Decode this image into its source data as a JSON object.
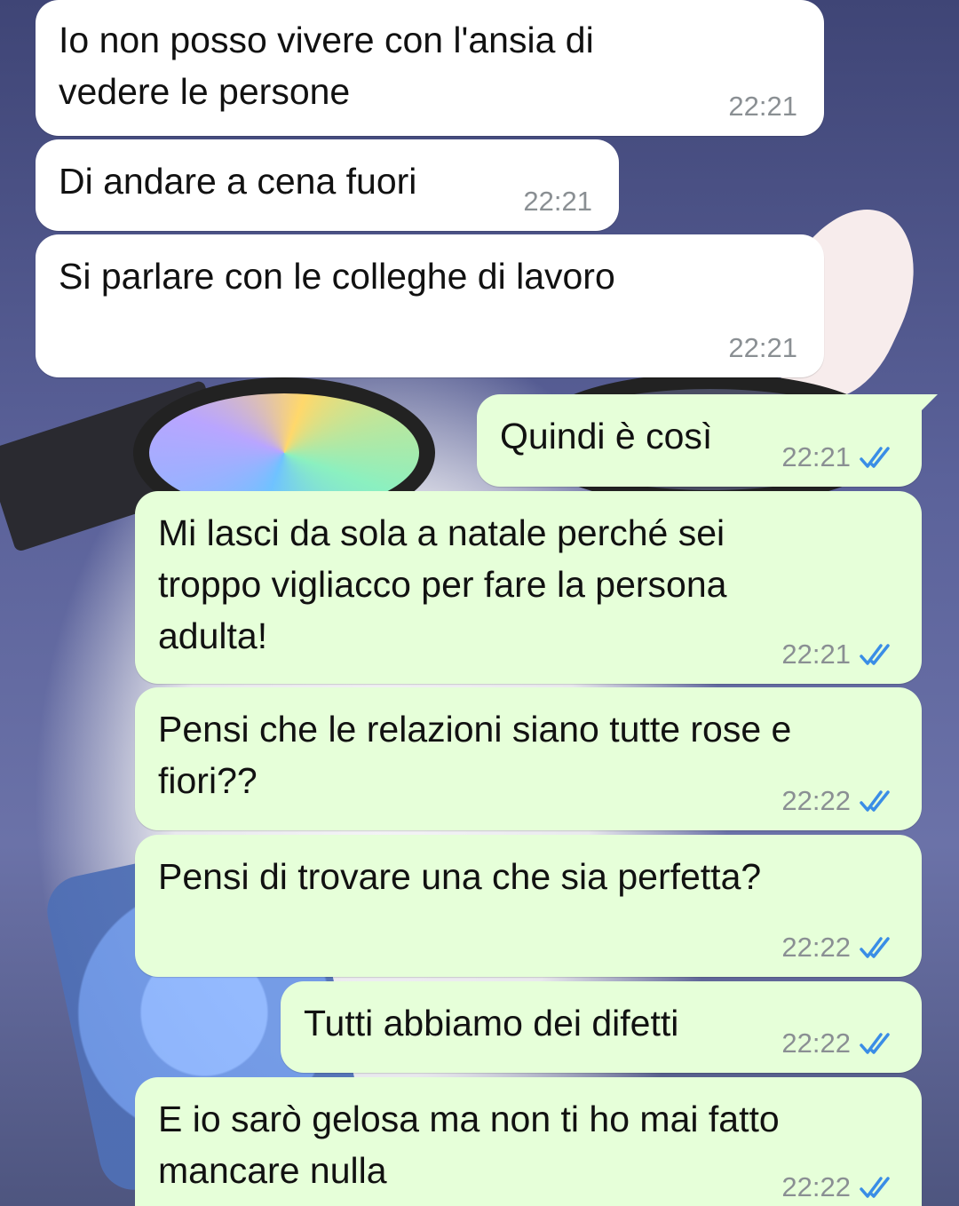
{
  "messages": [
    {
      "dir": "in",
      "text": "Io non posso vivere con l'ansia di\nvedere le persone",
      "time": "22:21"
    },
    {
      "dir": "in",
      "text": "Di andare a cena fuori",
      "time": "22:21"
    },
    {
      "dir": "in",
      "text": "Si parlare con le colleghe di lavoro",
      "time": "22:21"
    },
    {
      "dir": "out",
      "text": "Quindi è così",
      "time": "22:21",
      "status": "read"
    },
    {
      "dir": "out",
      "text": "Mi lasci da sola a natale perché sei\ntroppo vigliacco per fare la persona\nadulta!",
      "time": "22:21",
      "status": "read"
    },
    {
      "dir": "out",
      "text": "Pensi che le relazioni siano tutte rose e\nfiori??",
      "time": "22:22",
      "status": "read"
    },
    {
      "dir": "out",
      "text": "Pensi di trovare una che sia perfetta?",
      "time": "22:22",
      "status": "read"
    },
    {
      "dir": "out",
      "text": "Tutti abbiamo dei difetti",
      "time": "22:22",
      "status": "read"
    },
    {
      "dir": "out",
      "text": "E io sarò gelosa ma non ti ho mai fatto\nmancare nulla",
      "time": "22:22",
      "status": "read"
    }
  ],
  "colors": {
    "incoming_bubble": "#ffffff",
    "outgoing_bubble": "#e6ffd9",
    "read_ticks": "#3a8de6",
    "timestamp": "#8a8f93"
  },
  "icons": {
    "read_receipt": "double-check-icon"
  }
}
